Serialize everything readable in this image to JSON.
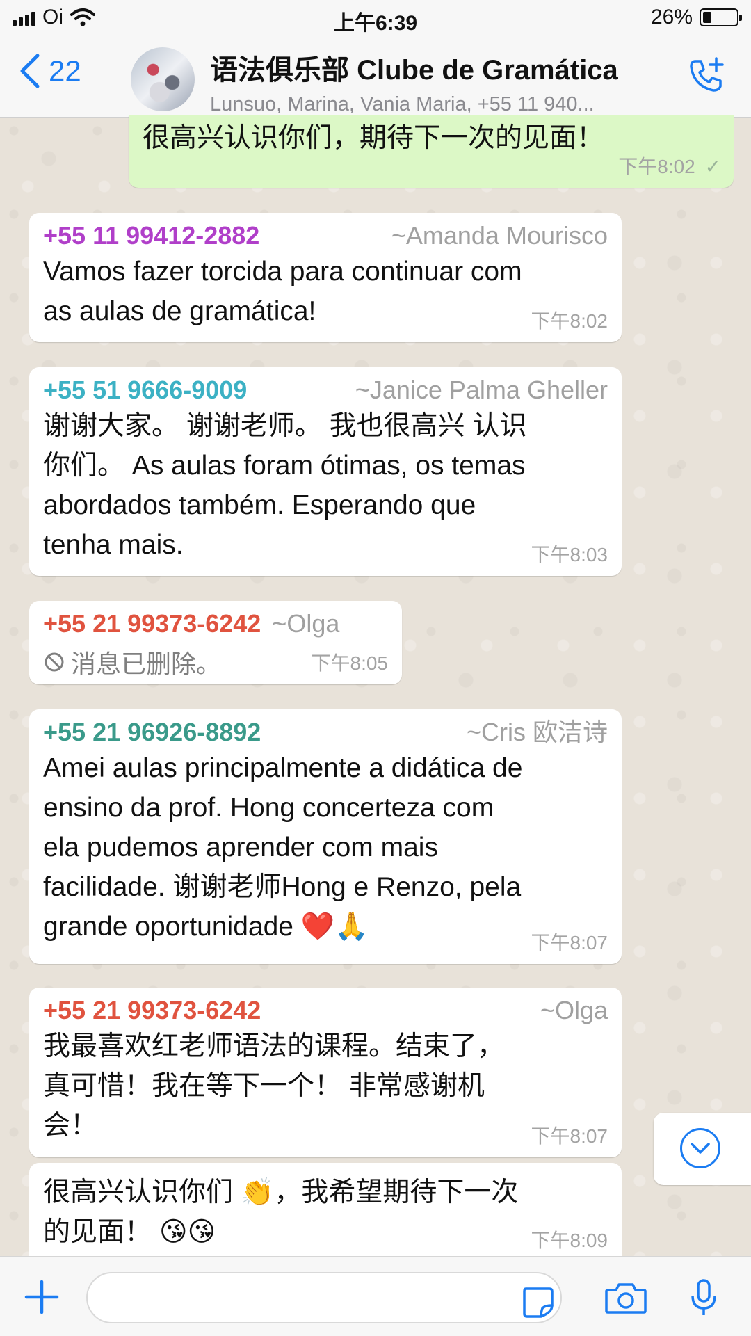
{
  "status_bar": {
    "carrier": "Oi",
    "time": "上午6:39",
    "battery_percent": "26%",
    "battery_level": 0.26
  },
  "header": {
    "back_count": "22",
    "title": "语法俱乐部 Clube de Gramática",
    "subtitle": "Lunsuo, Marina, Vania Maria, +55 11 940..."
  },
  "messages": [
    {
      "direction": "outgoing",
      "text": "很高兴认识你们，期待下一次的见面！",
      "time": "下午8:02",
      "status": "✓"
    },
    {
      "direction": "incoming",
      "phone": "+55 11 99412-2882",
      "name": "~Amanda Mourisco",
      "phone_color": "#b03fc9",
      "lines": [
        "Vamos fazer torcida para continuar com",
        "as aulas de gramática!"
      ],
      "time": "下午8:02"
    },
    {
      "direction": "incoming",
      "phone": "+55 51 9666-9009",
      "name": "~Janice Palma Gheller",
      "phone_color": "#3cb1c4",
      "lines": [
        "谢谢大家。 谢谢老师。 我也很高兴 认识",
        "你们。 As aulas foram ótimas, os temas",
        "abordados também. Esperando que",
        "tenha mais."
      ],
      "time": "下午8:03"
    },
    {
      "direction": "incoming",
      "phone": "+55 21 99373-6242",
      "name": "~Olga",
      "phone_color": "#e0533f",
      "deleted_text": "消息已删除。",
      "time": "下午8:05"
    },
    {
      "direction": "incoming",
      "phone": "+55 21 96926-8892",
      "name": "~Cris 欧洁诗",
      "phone_color": "#3a9a8a",
      "lines": [
        "Amei aulas principalmente a didática de",
        "ensino da prof. Hong concerteza com",
        "ela pudemos aprender com mais",
        "facilidade. 谢谢老师Hong e Renzo, pela",
        "grande oportunidade ❤️🙏"
      ],
      "time": "下午8:07"
    },
    {
      "direction": "incoming",
      "phone": "+55 21 99373-6242",
      "name": "~Olga",
      "phone_color": "#e0533f",
      "lines": [
        "我最喜欢红老师语法的课程。结束了，",
        "真可惜！我在等下一个！ 非常感谢机",
        "会！"
      ],
      "time": "下午8:07"
    },
    {
      "direction": "incoming",
      "lines": [
        "很高兴认识你们 👏，我希望期待下一次",
        "的见面！ 😘😘"
      ],
      "time": "下午8:09"
    }
  ]
}
